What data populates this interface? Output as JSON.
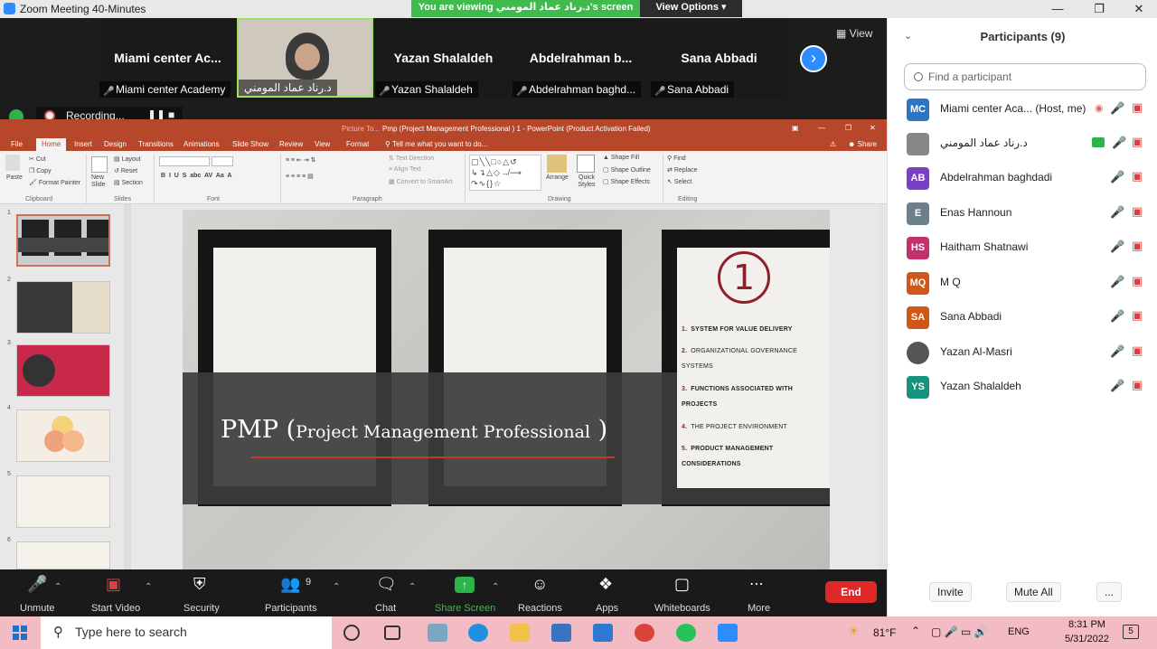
{
  "titlebar": {
    "title": "Zoom Meeting 40-Minutes"
  },
  "share_banner": {
    "text": "You are viewing د.رناد عماد المومني's screen",
    "view_options": "View Options"
  },
  "video_strip": {
    "tiles": [
      {
        "big": "Miami center Ac...",
        "label": "Miami center Academy"
      },
      {
        "big": "",
        "label": "د.رناد عماد المومني"
      },
      {
        "big": "Yazan Shalaldeh",
        "label": "Yazan Shalaldeh"
      },
      {
        "big": "Abdelrahman b...",
        "label": "Abdelrahman baghd..."
      },
      {
        "big": "Sana Abbadi",
        "label": "Sana Abbadi"
      }
    ],
    "view": "View",
    "recording": "Recording..."
  },
  "ppt": {
    "window_title": "Pmp (Project Management Professional ) 1 - PowerPoint (Product Activation Failed)",
    "picture_tools": "Picture To...",
    "tabs": [
      "File",
      "Home",
      "Insert",
      "Design",
      "Transitions",
      "Animations",
      "Slide Show",
      "Review",
      "View",
      "Format"
    ],
    "tell_me": "Tell me what you want to do...",
    "share": "Share",
    "ribbon": {
      "paste": "Paste",
      "cut": "Cut",
      "copy": "Copy",
      "format_painter": "Format Painter",
      "new_slide": "New Slide",
      "layout": "Layout",
      "reset": "Reset",
      "section": "Section",
      "text_direction": "Text Direction",
      "align_text": "Align Text",
      "convert_smartart": "Convert to SmartArt",
      "arrange": "Arrange",
      "quick_styles": "Quick Styles",
      "shape_fill": "Shape Fill",
      "shape_outline": "Shape Outline",
      "shape_effects": "Shape Effects",
      "find": "Find",
      "replace": "Replace",
      "select": "Select",
      "groups": [
        "Clipboard",
        "Slides",
        "Font",
        "Paragraph",
        "Drawing",
        "Editing"
      ]
    },
    "thumb_numbers": [
      "1",
      "2",
      "3",
      "4",
      "5",
      "6"
    ],
    "slide": {
      "title_main": "PMP",
      "title_sub": "Project Management Professional",
      "circle_number": "1",
      "items": [
        {
          "n": "1.",
          "text": "SYSTEM FOR VALUE DELIVERY",
          "bold": true
        },
        {
          "n": "2.",
          "text": "ORGANIZATIONAL GOVERNANCE SYSTEMS",
          "bold": false
        },
        {
          "n": "3.",
          "text": "FUNCTIONS ASSOCIATED WITH PROJECTS",
          "bold": true
        },
        {
          "n": "4.",
          "text": "THE PROJECT ENVIRONMENT",
          "bold": false
        },
        {
          "n": "5.",
          "text": "PRODUCT MANAGEMENT CONSIDERATIONS",
          "bold": true
        }
      ]
    }
  },
  "participants": {
    "title": "Participants (9)",
    "search_placeholder": "Find a participant",
    "list": [
      {
        "initials": "MC",
        "name": "Miami center Aca...  (Host, me)",
        "color": "#2e74c6"
      },
      {
        "initials": "",
        "name": "د.رناد عماد المومني",
        "color": "#888888"
      },
      {
        "initials": "AB",
        "name": "Abdelrahman baghdadi",
        "color": "#7b3fc4"
      },
      {
        "initials": "E",
        "name": "Enas Hannoun",
        "color": "#6e7f8c"
      },
      {
        "initials": "HS",
        "name": "Haitham Shatnawi",
        "color": "#c2316b"
      },
      {
        "initials": "MQ",
        "name": "M Q",
        "color": "#d0571a"
      },
      {
        "initials": "SA",
        "name": "Sana Abbadi",
        "color": "#d0571a"
      },
      {
        "initials": "",
        "name": "Yazan Al-Masri",
        "color": "#555555"
      },
      {
        "initials": "YS",
        "name": "Yazan Shalaldeh",
        "color": "#17927c"
      }
    ],
    "invite": "Invite",
    "mute_all": "Mute All",
    "more": "..."
  },
  "toolbar": {
    "unmute": "Unmute",
    "start_video": "Start Video",
    "security": "Security",
    "participants": "Participants",
    "participants_count": "9",
    "chat": "Chat",
    "share_screen": "Share Screen",
    "reactions": "Reactions",
    "apps": "Apps",
    "whiteboards": "Whiteboards",
    "more": "More",
    "end": "End"
  },
  "taskbar": {
    "search": "Type here to search",
    "temp": "81°F",
    "lang": "ENG",
    "time": "8:31 PM",
    "date": "5/31/2022",
    "notif": "5"
  },
  "colors": {
    "ppt_accent": "#b7472a",
    "zoom_blue": "#2d8cff",
    "share_green": "#3fba4c",
    "end_red": "#e02828",
    "taskbar": "#f3bcc4"
  }
}
